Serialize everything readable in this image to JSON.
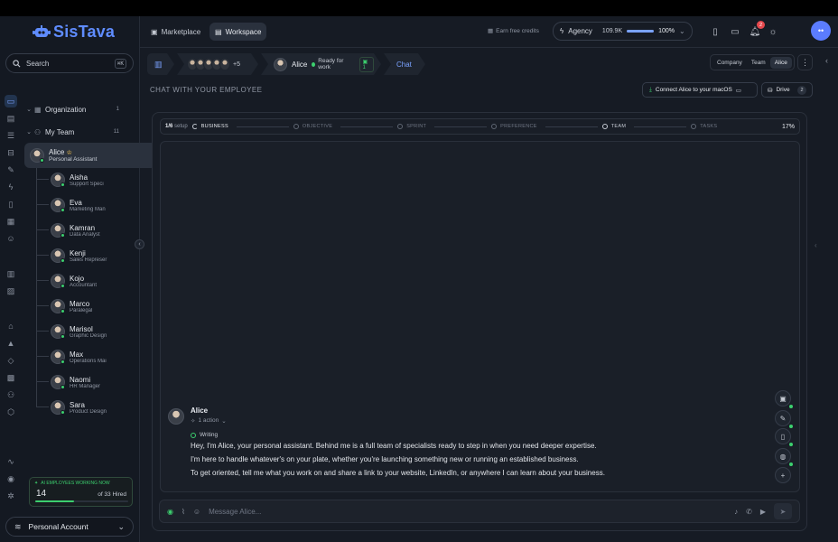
{
  "brand": {
    "name": "SisTava",
    "accent": "#5f8cff"
  },
  "search": {
    "label": "Search",
    "shortcut": "⌘K"
  },
  "tree": {
    "organization": {
      "label": "Organization",
      "count": "1"
    },
    "team": {
      "label": "My Team",
      "count": "11"
    },
    "alice": {
      "name": "Alice",
      "role": "Personal Assistant"
    },
    "members": [
      {
        "name": "Aisha",
        "role": "Support Speci"
      },
      {
        "name": "Eva",
        "role": "Marketing Man"
      },
      {
        "name": "Kamran",
        "role": "Data Analyst"
      },
      {
        "name": "Kenji",
        "role": "Sales Represer"
      },
      {
        "name": "Kojo",
        "role": "Accountant"
      },
      {
        "name": "Marco",
        "role": "Paralegal"
      },
      {
        "name": "Marisol",
        "role": "Graphic Design"
      },
      {
        "name": "Max",
        "role": "Operations Mai"
      },
      {
        "name": "Naomi",
        "role": "HR Manager"
      },
      {
        "name": "Sara",
        "role": "Product Design"
      }
    ]
  },
  "stats": {
    "title": "AI EMPLOYEES WORKING NOW",
    "working": "14",
    "of_hired": "of 33 Hired",
    "fraction": 0.42
  },
  "account": {
    "label": "Personal Account"
  },
  "header": {
    "tabs": [
      {
        "label": "Marketplace"
      },
      {
        "label": "Workspace"
      }
    ],
    "earn": "Earn free credits",
    "agency": {
      "label": "Agency",
      "credits": "109.9K",
      "percent": "100%"
    },
    "notifications": "2",
    "user_initial": "••"
  },
  "crumbs": {
    "more": "+5",
    "employee": "Alice",
    "status": "Ready for work",
    "tasks": "1",
    "chat": "Chat"
  },
  "scope": {
    "company": "Company",
    "team": "Team",
    "alice": "Alice"
  },
  "section_title": "CHAT WITH YOUR EMPLOYEE",
  "connect_label": "Connect Alice to your macOS",
  "drive": {
    "label": "Drive",
    "count": "2"
  },
  "progress": {
    "count": "1/6",
    "suffix": "setup",
    "steps": [
      "BUSINESS",
      "OBJECTIVE",
      "SPRINT",
      "PREFERENCE",
      "TEAM",
      "TASKS"
    ],
    "percent": "17%"
  },
  "message": {
    "author": "Alice",
    "actions": "1 action",
    "status": "Writing",
    "lines": [
      "Hey, I'm Alice, your personal assistant. Behind me is a full team of specialists ready to step in when you need deeper expertise.",
      "I'm here to handle whatever's on your plate, whether you're launching something new or running an established business.",
      "To get oriented, tell me what you work on and share a link to your website, LinkedIn, or anywhere I can learn about your business."
    ]
  },
  "composer": {
    "placeholder": "Message Alice..."
  }
}
